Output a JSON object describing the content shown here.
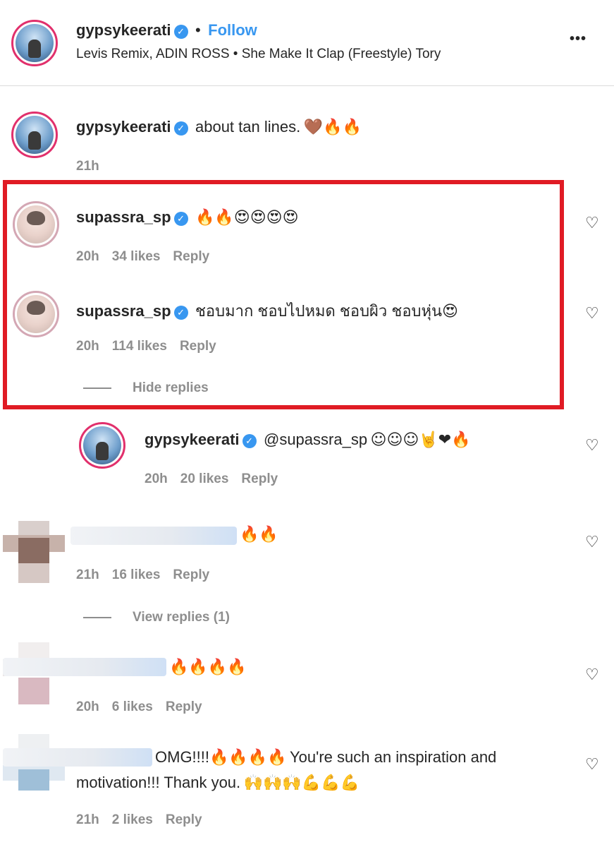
{
  "header": {
    "username": "gypsykeerati",
    "separator": "•",
    "follow_label": "Follow",
    "audio": "Levis Remix, ADIN ROSS • She Make It Clap (Freestyle) Tory",
    "more": "•••"
  },
  "caption": {
    "username": "gypsykeerati",
    "text": "about tan lines.",
    "emoji": "🤎🔥🔥",
    "time": "21h"
  },
  "comments": [
    {
      "username": "supassra_sp",
      "text": "",
      "emoji": "🔥🔥😍😍😍😍",
      "time": "20h",
      "likes": "34 likes",
      "reply": "Reply"
    },
    {
      "username": "supassra_sp",
      "text": "ชอบมาก ชอบไปหมด ชอบผิว ชอบหุ่น",
      "emoji": "😍",
      "time": "20h",
      "likes": "114 likes",
      "reply": "Reply",
      "toggle_label": "Hide replies"
    },
    {
      "username": "gypsykeerati",
      "text": "@supassra_sp",
      "emoji": "☺☺☺🤘❤🔥",
      "time": "20h",
      "likes": "20 likes",
      "reply": "Reply"
    },
    {
      "username": "",
      "emoji": "🔥🔥",
      "time": "21h",
      "likes": "16 likes",
      "reply": "Reply",
      "toggle_label": "View replies (1)"
    },
    {
      "username": "",
      "emoji": "🔥🔥🔥🔥",
      "time": "20h",
      "likes": "6 likes",
      "reply": "Reply"
    },
    {
      "username": "",
      "text1": "OMG!!!!",
      "emoji1": "🔥🔥🔥🔥",
      "text2": "You're such an inspiration and",
      "text3": "motivation!!! Thank you.",
      "emoji3": "🙌🙌🙌💪💪💪",
      "time": "21h",
      "likes": "2 likes",
      "reply": "Reply"
    }
  ],
  "icons": {
    "heart": "heart-outline-icon",
    "verified": "verified-badge-icon"
  },
  "colors": {
    "highlight_box": "#e01b24",
    "follow": "#3897f0",
    "verified": "#3897f0",
    "muted": "#8e8e8e"
  }
}
